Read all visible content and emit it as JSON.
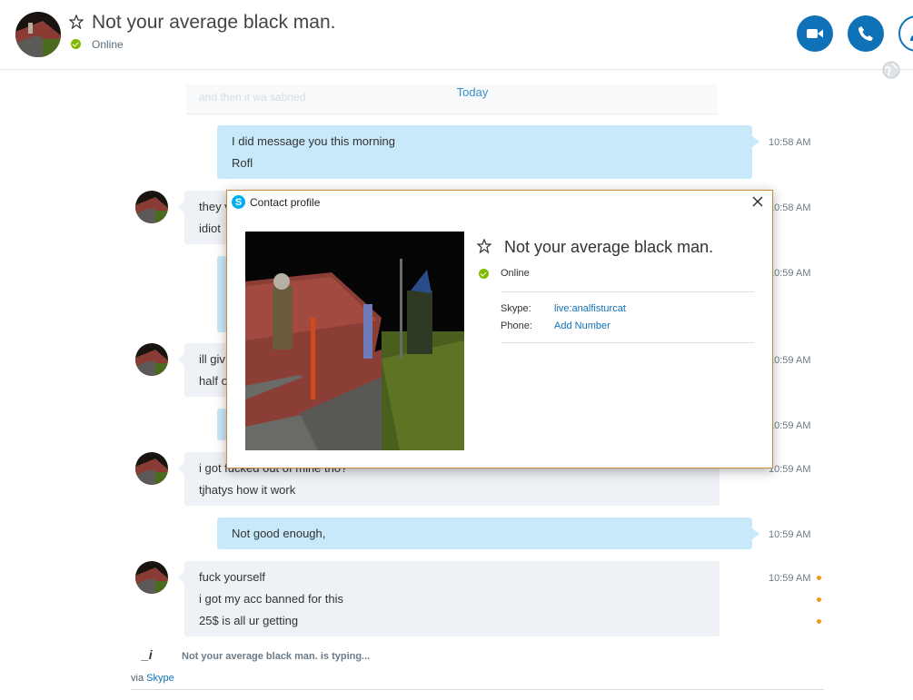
{
  "header": {
    "contact_name": "Not your average black man.",
    "status": "Online"
  },
  "conversation": {
    "ghost_text": "and then it wa sabned",
    "date_separator": "Today",
    "messages": [
      {
        "dir": "out",
        "lines": [
          "I did message you this morning",
          "Rofl"
        ],
        "time": "10:58 AM"
      },
      {
        "dir": "in",
        "lines": [
          "they v",
          "idiot"
        ],
        "time": "10:58 AM"
      },
      {
        "dir": "out",
        "lines": [],
        "time": "10:59 AM"
      },
      {
        "dir": "in",
        "lines": [
          "ill giv",
          "half o"
        ],
        "time": "10:59 AM"
      },
      {
        "dir": "out",
        "lines": [],
        "time": "10:59 AM"
      },
      {
        "dir": "in",
        "lines": [
          "i got fucked out of mine tho?",
          "tjhatys how it work"
        ],
        "time": "10:59 AM"
      },
      {
        "dir": "out",
        "lines": [
          "Not good enough,"
        ],
        "time": "10:59 AM"
      },
      {
        "dir": "in",
        "lines": [
          "fuck yourself",
          "i got my acc banned for this",
          "25$ is all ur getting"
        ],
        "time": "10:59 AM"
      }
    ],
    "typing_indicator": "_i",
    "typing_text": "Not your average black man. is typing...",
    "via_prefix": "via",
    "via_link": "Skype"
  },
  "dialog": {
    "title": "Contact profile",
    "name": "Not your average black man.",
    "status": "Online",
    "skype_label": "Skype:",
    "skype_value": "live:analfisturcat",
    "phone_label": "Phone:",
    "phone_value": "Add Number"
  },
  "colors": {
    "accent": "#0f72b8",
    "outgoing_bubble": "#c8e9fa",
    "incoming_bubble": "#eef1f5",
    "online": "#7fba00",
    "unread_dot": "#f39a14"
  }
}
